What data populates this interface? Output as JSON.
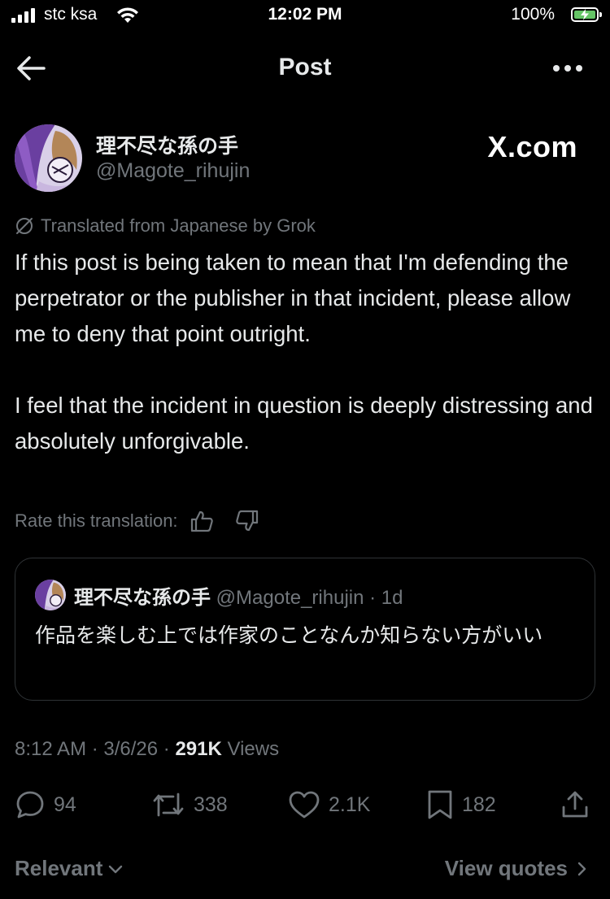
{
  "status_bar": {
    "carrier": "stc ksa",
    "time": "12:02 PM",
    "battery": "100%"
  },
  "header": {
    "title": "Post",
    "back_icon": "arrow-left-icon",
    "more_icon": "more-horizontal-icon"
  },
  "post": {
    "author_name": "理不尽な孫の手",
    "author_handle": "@Magote_rihujin",
    "source_badge": "X.com",
    "translation_note": "Translated from Japanese by Grok",
    "paragraphs": [
      "If this post is being taken to mean that I'm defending the perpetrator or the publisher in that incident, please allow me to deny that point outright.",
      "I feel that the incident in question is deeply distressing and absolutely unforgivable."
    ],
    "rate_label": "Rate this translation:",
    "meta": {
      "time": "8:12 AM",
      "date": "3/6/26",
      "views_count": "291K",
      "views_label": "Views"
    },
    "actions": {
      "replies": "94",
      "reposts": "338",
      "likes": "2.1K",
      "bookmarks": "182"
    }
  },
  "quoted_post": {
    "author_name": "理不尽な孫の手",
    "author_handle": "@Magote_rihujin",
    "age": "1d",
    "text": "作品を楽しむ上では作家のことなんか知らない方がいい"
  },
  "footer": {
    "sort_label": "Relevant",
    "view_quotes_label": "View quotes"
  },
  "colors": {
    "background": "#000000",
    "primary_text": "#e7e9ea",
    "secondary_text": "#71767b",
    "border": "#2f3336",
    "battery_green": "#65c466"
  }
}
